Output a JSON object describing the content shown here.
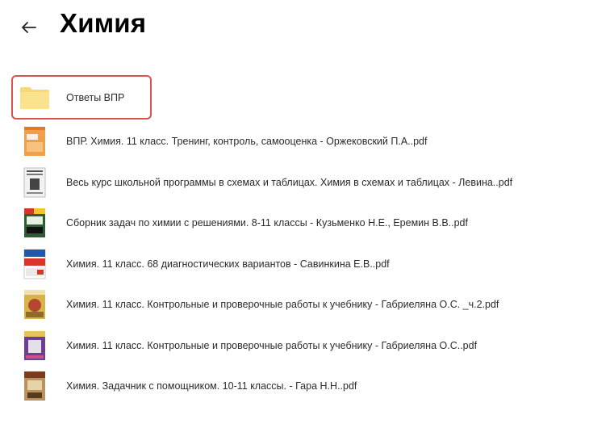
{
  "header": {
    "title": "Химия",
    "back_icon": "arrow-left-icon"
  },
  "files": [
    {
      "name": "Ответы ВПР",
      "type": "folder",
      "icon": "folder-icon",
      "color": "#fbe38e"
    },
    {
      "name": "ВПР. Химия. 11 класс. Тренинг, контроль, самооценка - Оржековский П.А..pdf",
      "type": "pdf",
      "icon": "book-cover-icon",
      "color": "#f0a04b"
    },
    {
      "name": "Весь курс школьной программы в схемах и таблицах. Химия в схемах и таблицах - Левина..pdf",
      "type": "pdf",
      "icon": "book-cover-icon",
      "color": "#e8e8e8"
    },
    {
      "name": "Сборник задач по химии с решениями. 8-11 классы - Кузьменко Н.Е., Еремин В.В..pdf",
      "type": "pdf",
      "icon": "book-cover-icon",
      "color": "#3a6b3e"
    },
    {
      "name": "Химия. 11 класс. 68 диагностических вариантов - Савинкина Е.В..pdf",
      "type": "pdf",
      "icon": "book-cover-icon",
      "color": "#d9342b"
    },
    {
      "name": "Химия. 11 класс. Контрольные и проверочные работы к учебнику - Габриеляна О.С. _ч.2.pdf",
      "type": "pdf",
      "icon": "book-cover-icon",
      "color": "#d7b44a"
    },
    {
      "name": "Химия. 11 класс. Контрольные и проверочные работы к учебнику - Габриеляна О.С..pdf",
      "type": "pdf",
      "icon": "book-cover-icon",
      "color": "#7a4fa0"
    },
    {
      "name": "Химия. Задачник с помощником. 10-11 классы. - Гара Н.Н..pdf",
      "type": "pdf",
      "icon": "book-cover-icon",
      "color": "#c9a36b"
    }
  ]
}
